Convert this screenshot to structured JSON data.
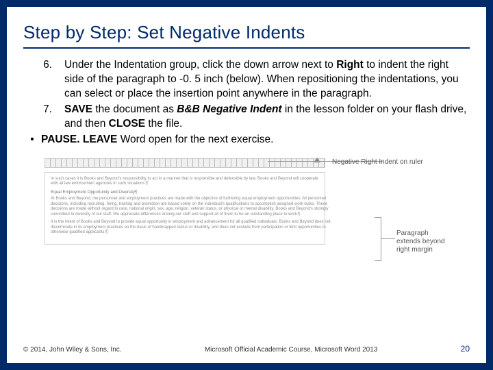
{
  "title": "Step by Step: Set Negative Indents",
  "steps": [
    {
      "num": "6.",
      "segments": [
        {
          "t": "Under the Indentation group, click the down arrow next to "
        },
        {
          "t": "Right",
          "b": true
        },
        {
          "t": " to indent the right side of the paragraph to -0. 5 inch (below). When repositioning the indentations, you can select or place the insertion point anywhere in the paragraph."
        }
      ]
    },
    {
      "num": "7.",
      "segments": [
        {
          "t": "SAVE",
          "b": true
        },
        {
          "t": " the document as "
        },
        {
          "t": "B&B Negative Indent",
          "b": true,
          "i": true
        },
        {
          "t": " in the lesson folder on your flash drive, and then "
        },
        {
          "t": "CLOSE",
          "b": true
        },
        {
          "t": " the file."
        }
      ]
    }
  ],
  "bullet": {
    "sym": "•",
    "segments": [
      {
        "t": "PAUSE. LEAVE",
        "b": true
      },
      {
        "t": " Word open for the next exercise."
      }
    ]
  },
  "callouts": {
    "top_right": "Negative Right Indent on ruler",
    "bottom_right": "Paragraph extends beyond right margin"
  },
  "doc_paragraphs": [
    "In such cases it is Books and Beyond's responsibility to act in a manner that is responsible and defensible by law. Books and Beyond will cooperate with all law enforcement agencies in such situations.¶",
    "Equal Employment Opportunity and Diversity¶",
    "At Books and Beyond, the personnel and employment practices are made with the objective of furthering equal employment opportunities. All personnel decisions, including recruiting, hiring, training and promotion are based solely on the individual's qualifications to accomplish assigned work tasks. These decisions are made without regard to race, national origin, sex, age, religion, veteran status, or physical or mental disability. Books and Beyond's strongly committed to diversity of our staff. We appreciate differences among our staff and support all of them to be an outstanding place to work.¶",
    "It is the intent of Books and Beyond to provide equal opportunity in employment and advancement for all qualified individuals. Books and Beyond does not discriminate in its employment practices on the basis of handicapped status or disability, and does not exclude from participation or limit opportunities to otherwise qualified applicants.¶"
  ],
  "footer": {
    "left": "© 2014, John Wiley & Sons, Inc.",
    "center": "Microsoft Official Academic Course, Microsoft Word 2013",
    "right": "20"
  }
}
